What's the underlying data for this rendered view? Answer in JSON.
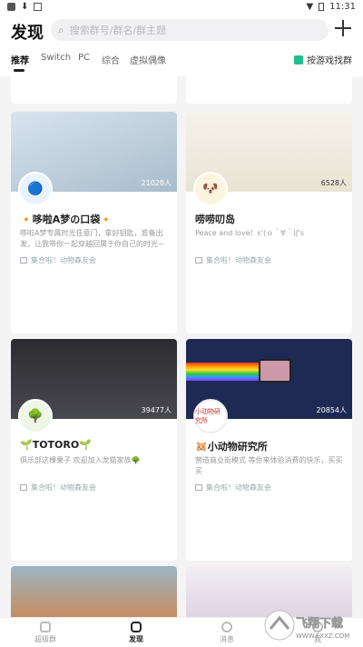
{
  "status_bar": {
    "time": "11:31"
  },
  "header": {
    "title": "发现",
    "search_placeholder": "搜索群号/群名/群主题"
  },
  "tabs": [
    {
      "label": "推荐",
      "active": true
    },
    {
      "label": "Switch"
    },
    {
      "label": "PC"
    },
    {
      "label": "综合"
    },
    {
      "label": "虚拟偶像"
    }
  ],
  "game_find": "按游戏找群",
  "cards": [
    {
      "name": "🔸哆啦A梦の口袋🔸",
      "count": "21028人",
      "desc": "哆啦A梦专属时光任意门，拿好钥匙，准备出发，让我带你一起穿越回属于你自己的时光~",
      "tags": "集合啦！动物森友会",
      "cover_color": "#c4d5e3",
      "avatar_text": "🔵"
    },
    {
      "name": "唠唠叨岛",
      "count": "6528人",
      "desc": "Peace and love！ε'(ｏ＾∀＾)ʃ's",
      "tags": "集合啦！动物森友会",
      "cover_color": "#f0ede3",
      "avatar_text": "🐶"
    },
    {
      "name": "🌱TOTORO🌱",
      "count": "39477人",
      "desc": "俱乐部这棵果子 欢迎加入龙猫家族🌳",
      "tags": "集合啦！动物森友会",
      "cover_color": "#3a3a3f",
      "avatar_text": "🌳"
    },
    {
      "name": "🐹小动物研究所",
      "count": "20854人",
      "desc": "营造商业街模式 等你来体验消费的快乐，买买买",
      "tags": "集合啦！动物森友会",
      "cover_color": "#1e2a54",
      "avatar_text": "小动物研究所"
    }
  ],
  "bottom_nav": [
    {
      "label": "超级群"
    },
    {
      "label": "发现",
      "active": true
    },
    {
      "label": "消息"
    },
    {
      "label": "我"
    }
  ],
  "watermark_text": "飞翔下载",
  "watermark_url": "WWW.FXXZ.COM"
}
